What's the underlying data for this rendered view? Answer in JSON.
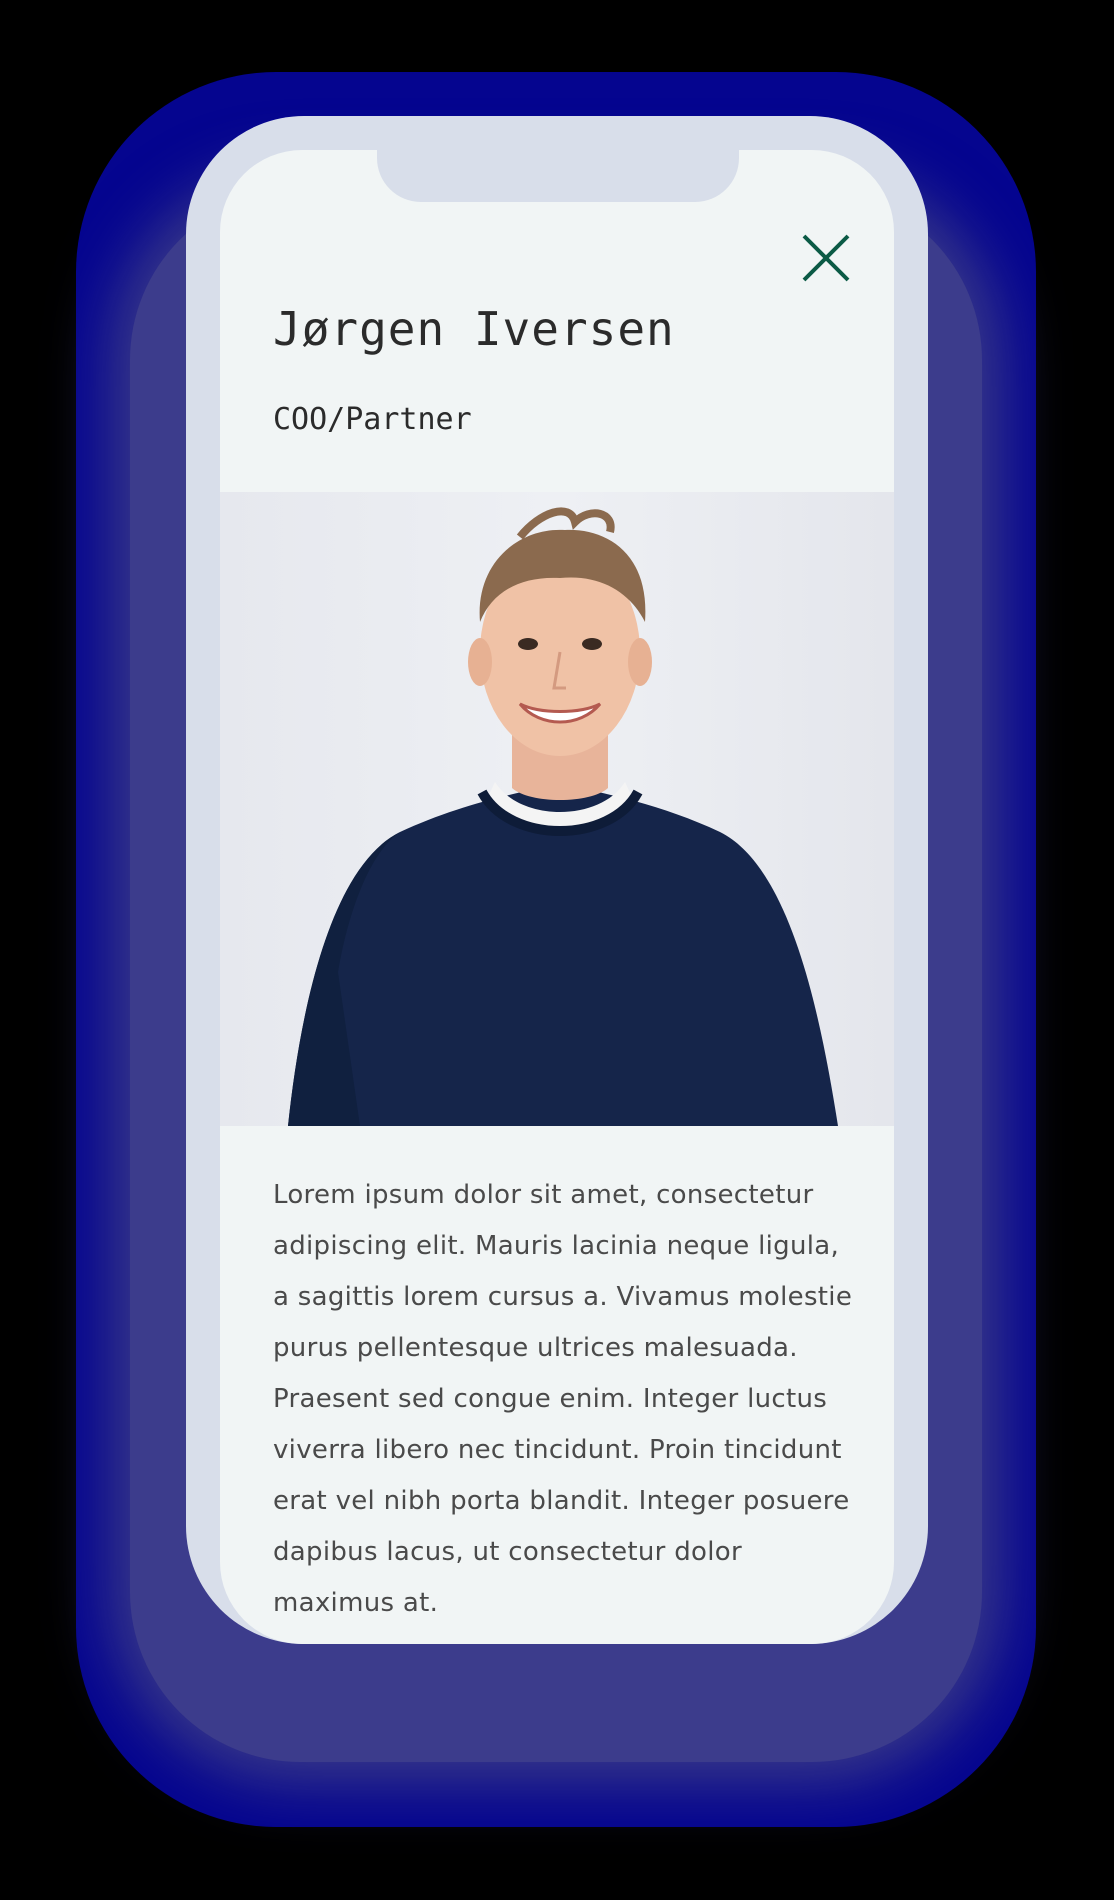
{
  "profile": {
    "name": "Jørgen Iversen",
    "role": "COO/Partner",
    "photo_alt": "Portrait of Jørgen Iversen",
    "bio": "Lorem ipsum dolor sit amet, consectetur adipiscing elit. Mauris lacinia neque ligula, a sagittis lorem cursus a. Vivamus molestie purus pellentesque ultrices malesuada. Praesent sed congue enim. Integer luctus viverra libero nec tincidunt. Proin tincidunt erat vel nibh porta blandit. Integer posuere dapibus lacus, ut consectetur dolor maximus at."
  },
  "close_icon": "close-icon",
  "colors": {
    "accent": "#0b5a45",
    "screen_bg": "#f1f5f5",
    "frame": "#d8deea",
    "glow": "#05058f"
  }
}
